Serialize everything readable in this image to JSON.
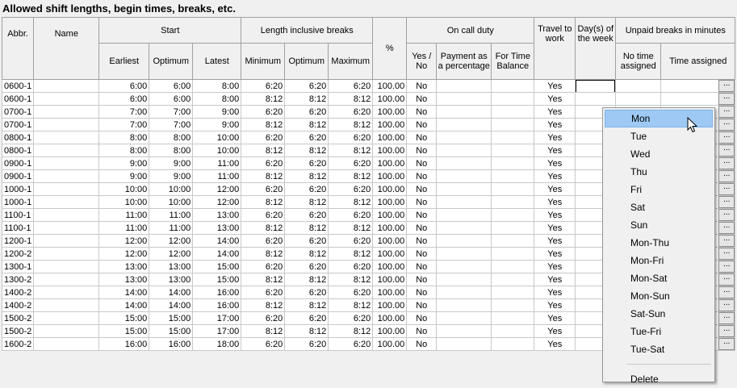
{
  "title": "Allowed shift lengths, begin times, breaks, etc.",
  "headers": {
    "abbr": "Abbr.",
    "name": "Name",
    "start": "Start",
    "start_earliest": "Earliest",
    "start_optimum": "Optimum",
    "start_latest": "Latest",
    "length": "Length inclusive breaks",
    "len_min": "Minimum",
    "len_opt": "Optimum",
    "len_max": "Maximum",
    "pct": "%",
    "oncall": "On call duty",
    "oncall_yesno": "Yes / No",
    "oncall_payment": "Payment as a percentage",
    "oncall_timebal": "For Time Balance",
    "travel": "Travel to work",
    "days": "Day(s) of the week",
    "unpaid": "Unpaid breaks in minutes",
    "unpaid_notime": "No time assigned",
    "unpaid_time": "Time assigned"
  },
  "rows": [
    {
      "abbr": "0600-1",
      "name": "",
      "earliest": "6:00",
      "optimum": "6:00",
      "latest": "8:00",
      "min": "6:20",
      "opt": "6:20",
      "max": "6:20",
      "pct": "100.00",
      "yesno": "No",
      "payment": "",
      "timebal": "",
      "travel": "Yes",
      "days": "",
      "notime": "",
      "btn": "..."
    },
    {
      "abbr": "0600-1",
      "name": "",
      "earliest": "6:00",
      "optimum": "6:00",
      "latest": "8:00",
      "min": "8:12",
      "opt": "8:12",
      "max": "8:12",
      "pct": "100.00",
      "yesno": "No",
      "payment": "",
      "timebal": "",
      "travel": "Yes",
      "days": "",
      "notime": "",
      "btn": "..."
    },
    {
      "abbr": "0700-1",
      "name": "",
      "earliest": "7:00",
      "optimum": "7:00",
      "latest": "9:00",
      "min": "6:20",
      "opt": "6:20",
      "max": "6:20",
      "pct": "100.00",
      "yesno": "No",
      "payment": "",
      "timebal": "",
      "travel": "Yes",
      "days": "",
      "notime": "",
      "btn": "..."
    },
    {
      "abbr": "0700-1",
      "name": "",
      "earliest": "7:00",
      "optimum": "7:00",
      "latest": "9:00",
      "min": "8:12",
      "opt": "8:12",
      "max": "8:12",
      "pct": "100.00",
      "yesno": "No",
      "payment": "",
      "timebal": "",
      "travel": "Yes",
      "days": "",
      "notime": "",
      "btn": "..."
    },
    {
      "abbr": "0800-1",
      "name": "",
      "earliest": "8:00",
      "optimum": "8:00",
      "latest": "10:00",
      "min": "6:20",
      "opt": "6:20",
      "max": "6:20",
      "pct": "100.00",
      "yesno": "No",
      "payment": "",
      "timebal": "",
      "travel": "Yes",
      "days": "",
      "notime": "",
      "btn": "..."
    },
    {
      "abbr": "0800-1",
      "name": "",
      "earliest": "8:00",
      "optimum": "8:00",
      "latest": "10:00",
      "min": "8:12",
      "opt": "8:12",
      "max": "8:12",
      "pct": "100.00",
      "yesno": "No",
      "payment": "",
      "timebal": "",
      "travel": "Yes",
      "days": "",
      "notime": "",
      "btn": "..."
    },
    {
      "abbr": "0900-1",
      "name": "",
      "earliest": "9:00",
      "optimum": "9:00",
      "latest": "11:00",
      "min": "6:20",
      "opt": "6:20",
      "max": "6:20",
      "pct": "100.00",
      "yesno": "No",
      "payment": "",
      "timebal": "",
      "travel": "Yes",
      "days": "",
      "notime": "",
      "btn": "..."
    },
    {
      "abbr": "0900-1",
      "name": "",
      "earliest": "9:00",
      "optimum": "9:00",
      "latest": "11:00",
      "min": "8:12",
      "opt": "8:12",
      "max": "8:12",
      "pct": "100.00",
      "yesno": "No",
      "payment": "",
      "timebal": "",
      "travel": "Yes",
      "days": "",
      "notime": "",
      "btn": "..."
    },
    {
      "abbr": "1000-1",
      "name": "",
      "earliest": "10:00",
      "optimum": "10:00",
      "latest": "12:00",
      "min": "6:20",
      "opt": "6:20",
      "max": "6:20",
      "pct": "100.00",
      "yesno": "No",
      "payment": "",
      "timebal": "",
      "travel": "Yes",
      "days": "",
      "notime": "",
      "btn": "..."
    },
    {
      "abbr": "1000-1",
      "name": "",
      "earliest": "10:00",
      "optimum": "10:00",
      "latest": "12:00",
      "min": "8:12",
      "opt": "8:12",
      "max": "8:12",
      "pct": "100.00",
      "yesno": "No",
      "payment": "",
      "timebal": "",
      "travel": "Yes",
      "days": "",
      "notime": "",
      "btn": "..."
    },
    {
      "abbr": "1100-1",
      "name": "",
      "earliest": "11:00",
      "optimum": "11:00",
      "latest": "13:00",
      "min": "6:20",
      "opt": "6:20",
      "max": "6:20",
      "pct": "100.00",
      "yesno": "No",
      "payment": "",
      "timebal": "",
      "travel": "Yes",
      "days": "",
      "notime": "",
      "btn": "..."
    },
    {
      "abbr": "1100-1",
      "name": "",
      "earliest": "11:00",
      "optimum": "11:00",
      "latest": "13:00",
      "min": "8:12",
      "opt": "8:12",
      "max": "8:12",
      "pct": "100.00",
      "yesno": "No",
      "payment": "",
      "timebal": "",
      "travel": "Yes",
      "days": "",
      "notime": "",
      "btn": "..."
    },
    {
      "abbr": "1200-1",
      "name": "",
      "earliest": "12:00",
      "optimum": "12:00",
      "latest": "14:00",
      "min": "6:20",
      "opt": "6:20",
      "max": "6:20",
      "pct": "100.00",
      "yesno": "No",
      "payment": "",
      "timebal": "",
      "travel": "Yes",
      "days": "",
      "notime": "",
      "btn": "..."
    },
    {
      "abbr": "1200-2",
      "name": "",
      "earliest": "12:00",
      "optimum": "12:00",
      "latest": "14:00",
      "min": "8:12",
      "opt": "8:12",
      "max": "8:12",
      "pct": "100.00",
      "yesno": "No",
      "payment": "",
      "timebal": "",
      "travel": "Yes",
      "days": "",
      "notime": "",
      "btn": "..."
    },
    {
      "abbr": "1300-1",
      "name": "",
      "earliest": "13:00",
      "optimum": "13:00",
      "latest": "15:00",
      "min": "6:20",
      "opt": "6:20",
      "max": "6:20",
      "pct": "100.00",
      "yesno": "No",
      "payment": "",
      "timebal": "",
      "travel": "Yes",
      "days": "",
      "notime": "",
      "btn": "..."
    },
    {
      "abbr": "1300-2",
      "name": "",
      "earliest": "13:00",
      "optimum": "13:00",
      "latest": "15:00",
      "min": "8:12",
      "opt": "8:12",
      "max": "8:12",
      "pct": "100.00",
      "yesno": "No",
      "payment": "",
      "timebal": "",
      "travel": "Yes",
      "days": "",
      "notime": "",
      "btn": "..."
    },
    {
      "abbr": "1400-2",
      "name": "",
      "earliest": "14:00",
      "optimum": "14:00",
      "latest": "16:00",
      "min": "6:20",
      "opt": "6:20",
      "max": "6:20",
      "pct": "100.00",
      "yesno": "No",
      "payment": "",
      "timebal": "",
      "travel": "Yes",
      "days": "",
      "notime": "",
      "btn": "..."
    },
    {
      "abbr": "1400-2",
      "name": "",
      "earliest": "14:00",
      "optimum": "14:00",
      "latest": "16:00",
      "min": "8:12",
      "opt": "8:12",
      "max": "8:12",
      "pct": "100.00",
      "yesno": "No",
      "payment": "",
      "timebal": "",
      "travel": "Yes",
      "days": "",
      "notime": "",
      "btn": "..."
    },
    {
      "abbr": "1500-2",
      "name": "",
      "earliest": "15:00",
      "optimum": "15:00",
      "latest": "17:00",
      "min": "6:20",
      "opt": "6:20",
      "max": "6:20",
      "pct": "100.00",
      "yesno": "No",
      "payment": "",
      "timebal": "",
      "travel": "Yes",
      "days": "",
      "notime": "",
      "btn": "..."
    },
    {
      "abbr": "1500-2",
      "name": "",
      "earliest": "15:00",
      "optimum": "15:00",
      "latest": "17:00",
      "min": "8:12",
      "opt": "8:12",
      "max": "8:12",
      "pct": "100.00",
      "yesno": "No",
      "payment": "",
      "timebal": "",
      "travel": "Yes",
      "days": "",
      "notime": "",
      "btn": "..."
    },
    {
      "abbr": "1600-2",
      "name": "",
      "earliest": "16:00",
      "optimum": "16:00",
      "latest": "18:00",
      "min": "6:20",
      "opt": "6:20",
      "max": "6:20",
      "pct": "100.00",
      "yesno": "No",
      "payment": "",
      "timebal": "",
      "travel": "Yes",
      "days": "",
      "notime": "",
      "btn": "..."
    }
  ],
  "menu": {
    "items": [
      "Mon",
      "Tue",
      "Wed",
      "Thu",
      "Fri",
      "Sat",
      "Sun",
      "Mon-Thu",
      "Mon-Fri",
      "Mon-Sat",
      "Mon-Sun",
      "Sat-Sun",
      "Tue-Fri",
      "Tue-Sat"
    ],
    "active_index": 0,
    "delete_label": "Delete"
  }
}
